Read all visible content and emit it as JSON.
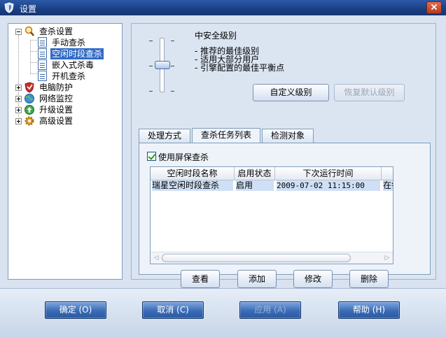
{
  "window": {
    "title": "设置"
  },
  "tree": {
    "items": [
      {
        "label": "查杀设置",
        "icon": "magnifier-icon"
      },
      {
        "label": "手动查杀"
      },
      {
        "label": "空闲时段查杀"
      },
      {
        "label": "嵌入式杀毒"
      },
      {
        "label": "开机查杀"
      },
      {
        "label": "电脑防护",
        "icon": "shield-icon"
      },
      {
        "label": "网络监控",
        "icon": "globe-icon"
      },
      {
        "label": "升级设置",
        "icon": "update-icon"
      },
      {
        "label": "高级设置",
        "icon": "gear-icon"
      }
    ],
    "selected_index": 2
  },
  "security_level": {
    "title": "中安全级别",
    "desc": [
      "- 推荐的最佳级别",
      "- 适用大部分用户",
      "- 引擎配置的最佳平衡点"
    ],
    "slider_position": "middle",
    "custom_button": "自定义级别",
    "restore_button": "恢复默认级别"
  },
  "tabs": [
    "处理方式",
    "查杀任务列表",
    "检测对象"
  ],
  "active_tab": 1,
  "task_list": {
    "use_screensaver_label": "使用屏保查杀",
    "use_screensaver_checked": true,
    "columns": [
      "空闲时段名称",
      "启用状态",
      "下次运行时间",
      ""
    ],
    "rows": [
      {
        "name": "瑞星空闲时段查杀",
        "status": "启用",
        "next_run": "2009-07-02  11:15:00",
        "extra": "在每天"
      }
    ],
    "buttons": {
      "view": "查看",
      "add": "添加",
      "edit": "修改",
      "delete": "删除"
    }
  },
  "footer": {
    "ok": "确定 (O)",
    "cancel": "取消 (C)",
    "apply": "应用 (A)",
    "help": "帮助 (H)"
  },
  "colors": {
    "title_bar": "#1a3e82",
    "selection": "#316ac5",
    "client_bg": "#d8e2f0"
  }
}
